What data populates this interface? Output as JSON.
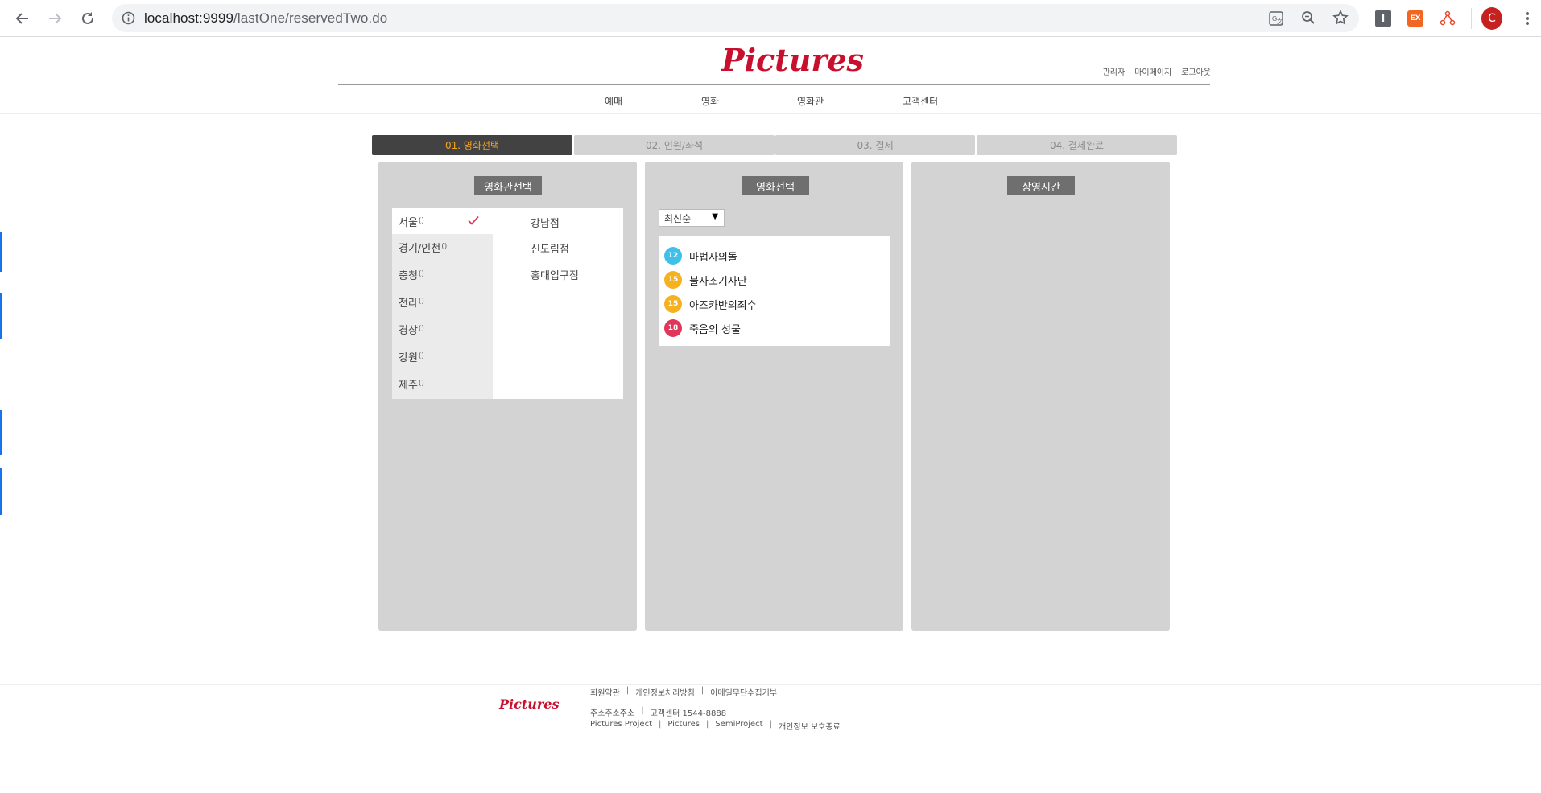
{
  "browser": {
    "url_host": "localhost:9999",
    "url_path": "/lastOne/reservedTwo.do",
    "profile_initial": "C",
    "ext_ex_label": "EX",
    "ext_i_label": "I"
  },
  "header": {
    "logo": "Pictures",
    "util_links": [
      "관리자",
      "마이페이지",
      "로그아웃"
    ],
    "nav": [
      "예매",
      "영화",
      "영화관",
      "고객센터"
    ]
  },
  "steps": [
    "01. 영화선택",
    "02. 인원/좌석",
    "03. 결제",
    "04. 결제완료"
  ],
  "theater_panel": {
    "title": "영화관선택",
    "regions": [
      {
        "name": "서울",
        "count": "()"
      },
      {
        "name": "경기/인천",
        "count": "()"
      },
      {
        "name": "충청",
        "count": "()"
      },
      {
        "name": "전라",
        "count": "()"
      },
      {
        "name": "경상",
        "count": "()"
      },
      {
        "name": "강원",
        "count": "()"
      },
      {
        "name": "제주",
        "count": "()"
      }
    ],
    "theaters": [
      "강남점",
      "신도림점",
      "홍대입구점"
    ]
  },
  "movie_panel": {
    "title": "영화선택",
    "sort_selected": "최신순",
    "movies": [
      {
        "rating": "12",
        "title": "마법사의돌",
        "color": "#3fc0e8"
      },
      {
        "rating": "15",
        "title": "불사조기사단",
        "color": "#f5b21e"
      },
      {
        "rating": "15",
        "title": "아즈카반의죄수",
        "color": "#f5b21e"
      },
      {
        "rating": "18",
        "title": "죽음의 성물",
        "color": "#e2355a"
      }
    ]
  },
  "time_panel": {
    "title": "상영시간"
  },
  "footer": {
    "logo": "Pictures",
    "row1": [
      "회원약관",
      "개인정보처리방침",
      "이메일무단수집거부"
    ],
    "row2_address": "주소주소주소",
    "row2_center": "고객센터 1544-8888",
    "row3": [
      "Pictures Project",
      "Pictures",
      "SemiProject",
      "개인정보 보호종료"
    ]
  },
  "colors": {
    "accent_orange": "#f7a21b",
    "logo_red": "#c8102e",
    "check_red": "#e2355a"
  }
}
